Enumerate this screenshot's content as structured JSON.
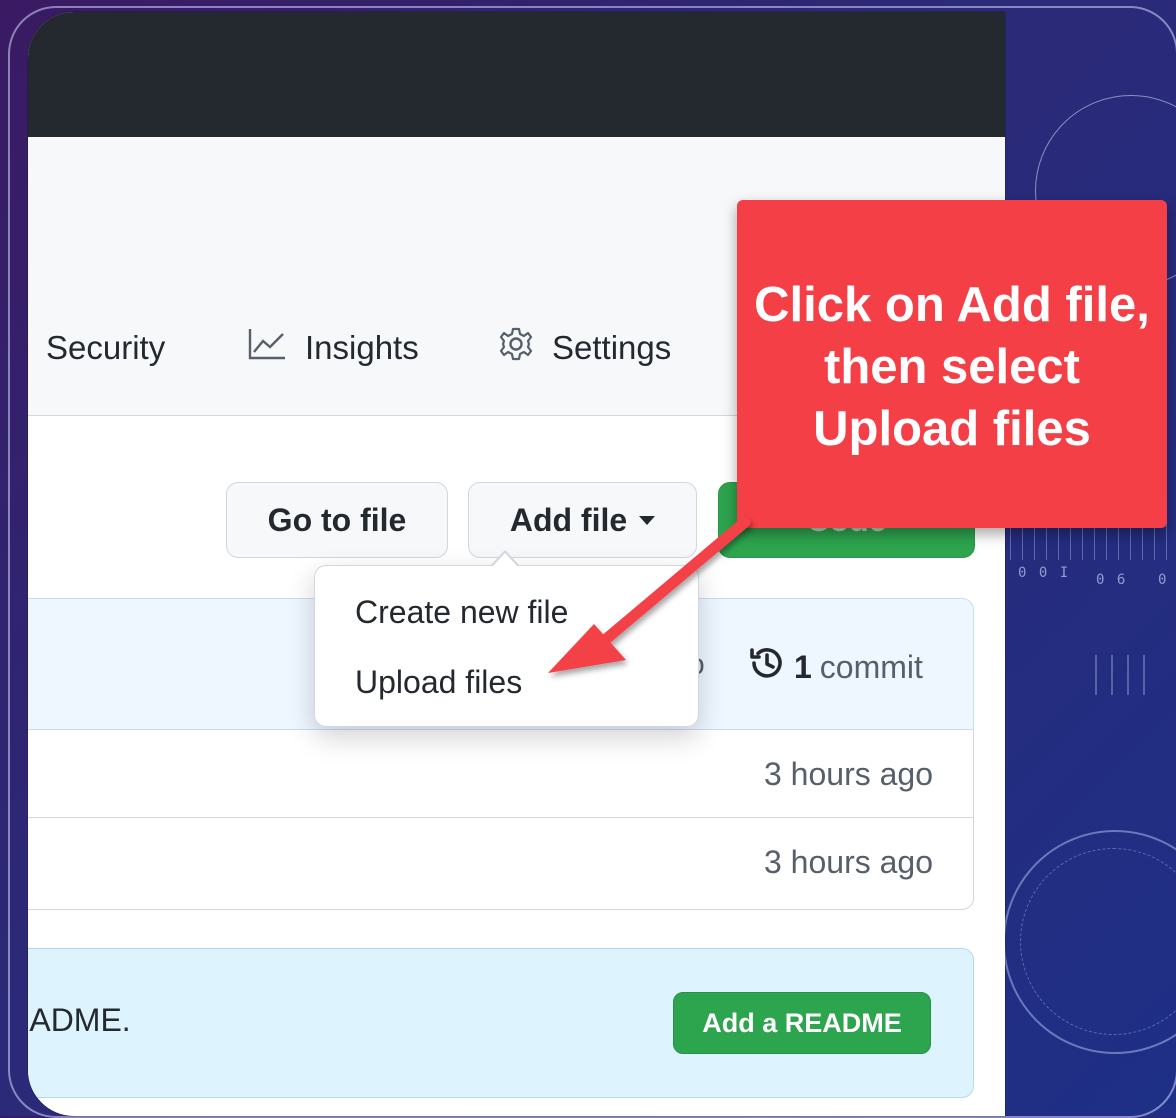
{
  "nav_tabs": [
    {
      "label": "Security",
      "icon": "shield-icon"
    },
    {
      "label": "Insights",
      "icon": "graph-icon"
    },
    {
      "label": "Settings",
      "icon": "gear-icon"
    }
  ],
  "buttons": {
    "go_to_file": "Go to file",
    "add_file": "Add file",
    "code": "Code"
  },
  "dropdown": {
    "items": [
      "Create new file",
      "Upload files"
    ]
  },
  "commit_bar": {
    "fragment": "o",
    "count": "1",
    "count_label": "commit"
  },
  "files": [
    {
      "time": "3 hours ago"
    },
    {
      "time": "3 hours ago"
    }
  ],
  "readme": {
    "text": "EADME.",
    "button": "Add a README"
  },
  "annotation": {
    "text": "Click on Add file, then select Upload files",
    "color": "#f43f47"
  },
  "background_digits": [
    "0 0 I",
    "0 6",
    "0"
  ],
  "colors": {
    "header_dark": "#24292f",
    "primary_green": "#2da44e",
    "banner_blue": "#ddf4ff"
  }
}
